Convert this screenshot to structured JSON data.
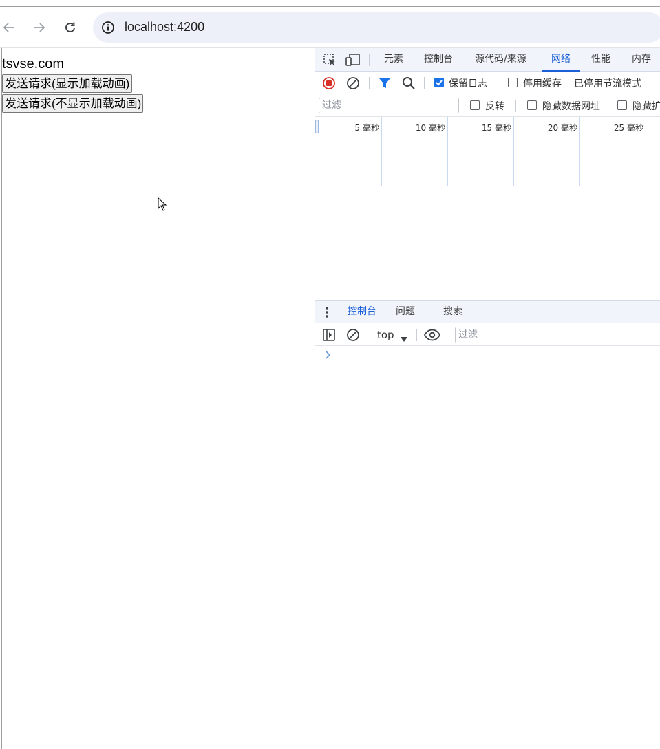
{
  "browser": {
    "url": "localhost:4200",
    "icons": [
      "back-arrow-icon",
      "forward-arrow-icon",
      "reload-icon",
      "site-info-icon"
    ]
  },
  "page": {
    "title": "tsvse.com",
    "buttons": [
      {
        "label": "发送请求(显示加载动画)"
      },
      {
        "label": "发送请求(不显示加载动画)"
      }
    ]
  },
  "devtools": {
    "tabs": [
      {
        "label": "元素",
        "active": false
      },
      {
        "label": "控制台",
        "active": false
      },
      {
        "label": "源代码/来源",
        "active": false
      },
      {
        "label": "网络",
        "active": true
      },
      {
        "label": "性能",
        "active": false
      },
      {
        "label": "内存",
        "active": false
      }
    ],
    "network_toolbar": {
      "preserve_log": {
        "label": "保留日志",
        "checked": true
      },
      "disable_cache": {
        "label": "停用缓存",
        "checked": false
      },
      "throttling": "已停用节流模式"
    },
    "filter_bar": {
      "placeholder": "过滤",
      "invert": {
        "label": "反转",
        "checked": false
      },
      "hide_data_urls": {
        "label": "隐藏数据网址",
        "checked": false
      },
      "hide_extension": {
        "label": "隐藏扩",
        "checked": false
      }
    },
    "timeline": {
      "labels": [
        "5 毫秒",
        "10 毫秒",
        "15 毫秒",
        "20 毫秒",
        "25 毫秒"
      ]
    },
    "drawer": {
      "tabs": [
        {
          "label": "控制台",
          "active": true
        },
        {
          "label": "问题",
          "active": false
        },
        {
          "label": "搜索",
          "active": false
        }
      ],
      "context": "top",
      "filter_placeholder": "过滤"
    },
    "colors": {
      "accent": "#1a5fd6",
      "record": "#d93025",
      "checkbox": "#1a73e8"
    }
  }
}
